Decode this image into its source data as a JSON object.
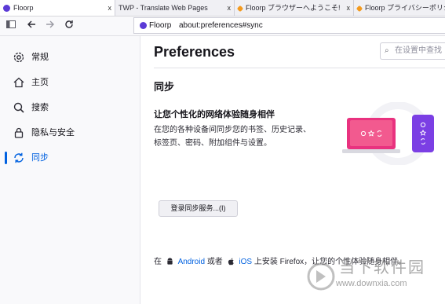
{
  "tabs": [
    {
      "title": "Floorp",
      "favicon_color": "#5b3ad6",
      "close": "x",
      "active": true
    },
    {
      "title": "TWP - Translate Web Pages",
      "favicon_color": "",
      "close": "x",
      "active": false
    },
    {
      "title": "Floorp ブラウザーへようこそ!",
      "favicon_color": "#f39a1e",
      "close": "x",
      "active": false
    },
    {
      "title": "Floorp プライバシーポリシー",
      "favicon_color": "#f39a1e",
      "close": "",
      "active": false
    }
  ],
  "urlbar": {
    "brand": "Floorp",
    "url": "about:preferences#sync"
  },
  "sidebar": {
    "items": [
      {
        "label": "常规",
        "icon": "gear-icon"
      },
      {
        "label": "主页",
        "icon": "home-icon"
      },
      {
        "label": "搜索",
        "icon": "search-icon"
      },
      {
        "label": "隐私与安全",
        "icon": "lock-icon"
      },
      {
        "label": "同步",
        "icon": "sync-icon",
        "selected": true
      }
    ]
  },
  "main": {
    "title": "Preferences",
    "search_placeholder": "在设置中查找",
    "section_title": "同步",
    "heading": "让您个性化的网络体验随身相伴",
    "description_line1": "在您的各种设备间同步您的书签、历史记录、",
    "description_line2": "标签页、密码、附加组件与设置。",
    "sign_in_button": "登录同步服务...(I)",
    "footer": {
      "prefix": "在",
      "android": "Android",
      "or": "或者",
      "ios": "iOS",
      "suffix": "上安装 Firefox，让您的个性体验随身相伴。"
    }
  },
  "watermark": {
    "text1": "当下软件园",
    "text2": "www.downxia.com"
  },
  "colors": {
    "accent": "#0061e0",
    "brand": "#5b3ad6",
    "illustration_pink": "#e9327f",
    "illustration_purple": "#7b3fe4"
  }
}
